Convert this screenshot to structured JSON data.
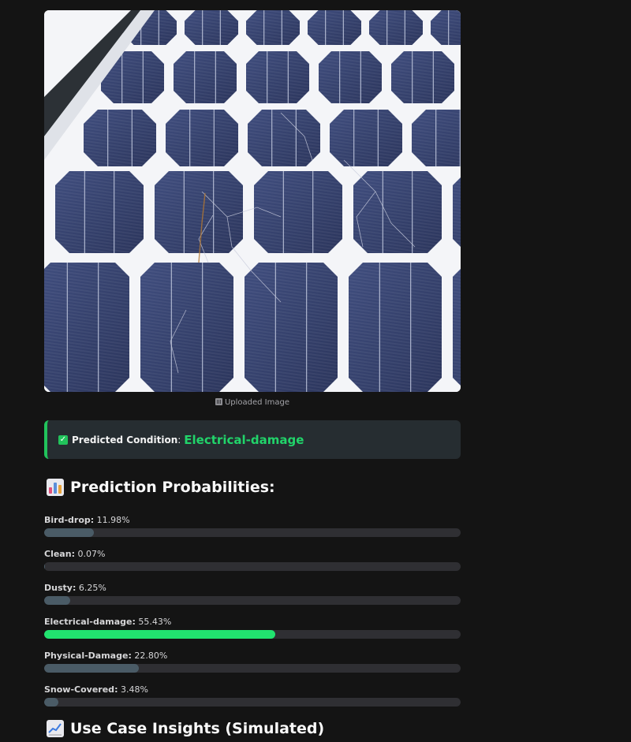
{
  "image": {
    "caption": "Uploaded Image",
    "caption_icon": "image-frame-icon"
  },
  "prediction": {
    "label": "Predicted Condition",
    "value": "Electrical-damage",
    "icon": "checkmark-icon",
    "accent": "#21c35b"
  },
  "probabilities": {
    "title": "Prediction Probabilities:",
    "icon": "bar-chart-icon",
    "items": [
      {
        "label": "Bird-drop",
        "display": "11.98%",
        "value": 0.1198
      },
      {
        "label": "Clean",
        "display": "0.07%",
        "value": 0.0007
      },
      {
        "label": "Dusty",
        "display": "6.25%",
        "value": 0.0625
      },
      {
        "label": "Electrical-damage",
        "display": "55.43%",
        "value": 0.5543
      },
      {
        "label": "Physical-Damage",
        "display": "22.80%",
        "value": 0.228
      },
      {
        "label": "Snow-Covered",
        "display": "3.48%",
        "value": 0.0348
      }
    ],
    "bar_color": "#4a5b66",
    "highlight_color": "#21e36f"
  },
  "insights": {
    "title": "Use Case Insights (Simulated)",
    "icon": "trend-chart-icon"
  }
}
